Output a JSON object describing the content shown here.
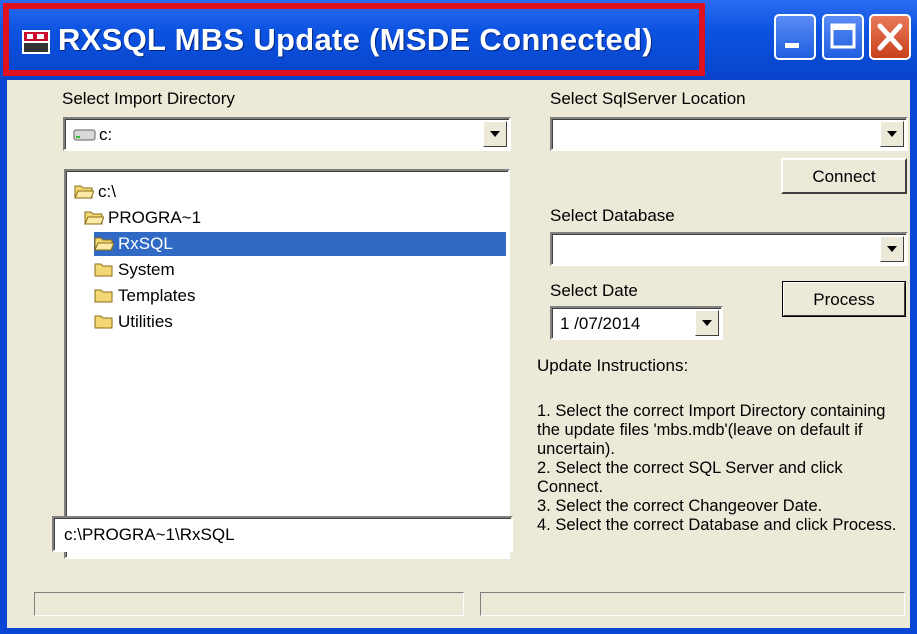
{
  "window": {
    "title": "RXSQL MBS Update (MSDE Connected)",
    "highlight_color": "#e0101e",
    "titlebar_color": "#0b52e0"
  },
  "import_dir": {
    "label": "Select Import Directory",
    "drive_value": "c:",
    "drive_icon": "drive-icon"
  },
  "tree": {
    "items": [
      {
        "label": "c:\\",
        "level": 0,
        "icon": "open-folder-icon",
        "selected": false
      },
      {
        "label": "PROGRA~1",
        "level": 0,
        "icon": "open-folder-icon",
        "selected": false
      },
      {
        "label": "RxSQL",
        "level": 1,
        "icon": "open-folder-icon",
        "selected": true
      },
      {
        "label": "System",
        "level": 1,
        "icon": "folder-icon",
        "selected": false
      },
      {
        "label": "Templates",
        "level": 1,
        "icon": "folder-icon",
        "selected": false
      },
      {
        "label": "Utilities",
        "level": 1,
        "icon": "folder-icon",
        "selected": false
      }
    ],
    "selection_color": "#316ac5"
  },
  "path_box": {
    "value": "c:\\PROGRA~1\\RxSQL"
  },
  "sql_server": {
    "label": "Select SqlServer Location",
    "value": ""
  },
  "connect_button": {
    "label": "Connect"
  },
  "database": {
    "label": "Select Database",
    "value": ""
  },
  "date": {
    "label": "Select Date",
    "value": "1 /07/2014"
  },
  "process_button": {
    "label": "Process"
  },
  "instructions": {
    "heading": "Update Instructions:",
    "step1": "1. Select the correct Import Directory containing the update files 'mbs.mdb'(leave on default if uncertain).",
    "step2": "2. Select the correct SQL Server and click Connect.",
    "step3": "3. Select the correct Changeover Date.",
    "step4": "4. Select the correct Database and click Process."
  }
}
